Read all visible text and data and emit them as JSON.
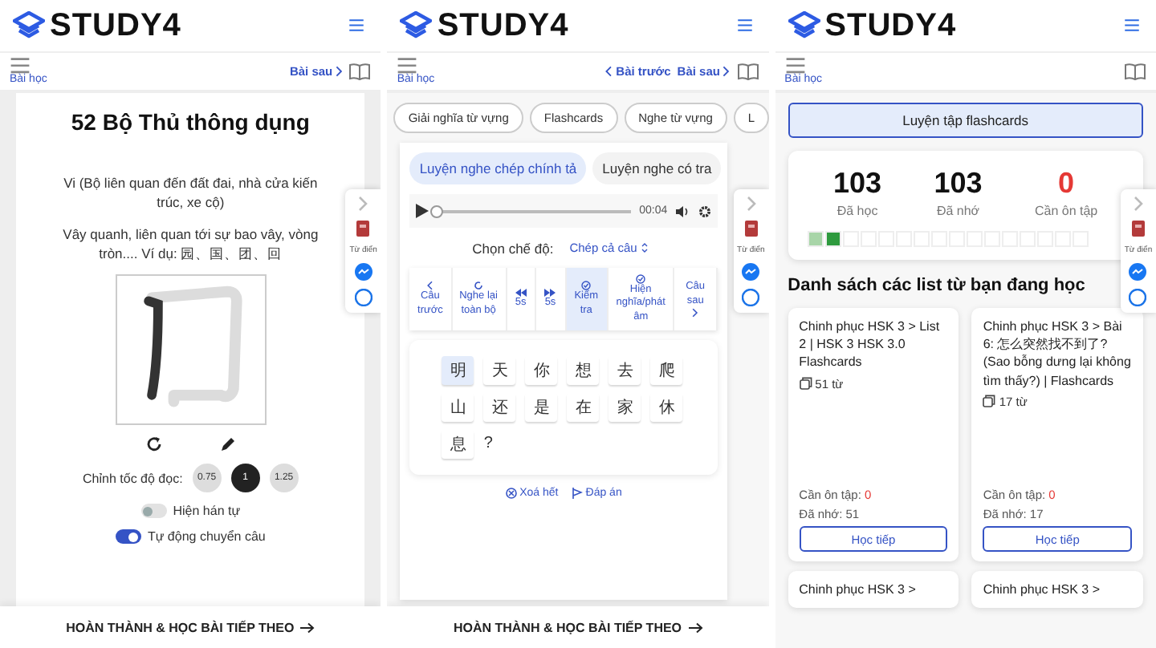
{
  "screens": [
    {
      "kind": "stroke",
      "logo": "STUDY4",
      "menu_label": "Bài học",
      "next_link": "Bài sau",
      "title": "52 Bộ Thủ thông dụng",
      "description": [
        "Vi (Bộ liên quan đến đất đai, nhà cửa kiến trúc, xe cộ)",
        "Vây quanh, liên quan tới sự bao vây, vòng tròn.... Ví dụ: 园、国、团、回"
      ],
      "speed_label": "Chỉnh tốc độ đọc:",
      "speeds": [
        {
          "label": "0.75",
          "selected": false
        },
        {
          "label": "1",
          "selected": true
        },
        {
          "label": "1.25",
          "selected": false
        }
      ],
      "toggles": [
        {
          "label": "Hiện hán tự",
          "on": false
        },
        {
          "label": "Tự động chuyển câu",
          "on": true
        }
      ],
      "footer": "HOÀN THÀNH & HỌC BÀI TIẾP THEO",
      "dictionary_label": "Từ điển"
    },
    {
      "kind": "dictation",
      "logo": "STUDY4",
      "menu_label": "Bài học",
      "prev_link": "Bài trước",
      "next_link": "Bài sau",
      "chips": [
        "Giải nghĩa từ vựng",
        "Flashcards",
        "Nghe từ vựng",
        "L"
      ],
      "modes": [
        {
          "label": "Luyện nghe chép chính tả",
          "selected": true
        },
        {
          "label": "Luyện nghe có tra",
          "selected": false
        }
      ],
      "player": {
        "level": 0,
        "time": "00:04"
      },
      "mode_label": "Chọn chế độ:",
      "mode_value": "Chép cả câu",
      "controls": [
        {
          "kind": "prev",
          "label": "Câu trước",
          "active": false
        },
        {
          "kind": "replay",
          "label": "Nghe lại toàn bộ",
          "active": false
        },
        {
          "kind": "back",
          "label": "5s",
          "active": false
        },
        {
          "kind": "forward",
          "label": "5s",
          "active": false
        },
        {
          "kind": "check",
          "label": "Kiểm tra",
          "active": true
        },
        {
          "kind": "meaning",
          "label": "Hiện nghĩa/phát âm",
          "active": false
        },
        {
          "kind": "next",
          "label": "Câu sau",
          "active": false
        }
      ],
      "tiles": [
        {
          "text": "明",
          "selected": true
        },
        {
          "text": "天",
          "selected": false
        },
        {
          "text": "你",
          "selected": false
        },
        {
          "text": "想",
          "selected": false
        },
        {
          "text": "去",
          "selected": false
        },
        {
          "text": "爬",
          "selected": false
        },
        {
          "text": "山",
          "selected": false
        },
        {
          "text": "还",
          "selected": false
        },
        {
          "text": "是",
          "selected": false
        },
        {
          "text": "在",
          "selected": false
        },
        {
          "text": "家",
          "selected": false
        },
        {
          "text": "休",
          "selected": false
        },
        {
          "text": "息",
          "selected": false
        }
      ],
      "trailing": "?",
      "actions": [
        {
          "kind": "clear",
          "label": "Xoá hết"
        },
        {
          "kind": "answer",
          "label": "Đáp án"
        }
      ],
      "footer": "HOÀN THÀNH & HỌC BÀI TIẾP THEO",
      "dictionary_label": "Từ điển"
    },
    {
      "kind": "flashcards",
      "logo": "STUDY4",
      "menu_label": "Bài học",
      "practice_button": "Luyện tập flashcards",
      "stats": [
        {
          "value": "103",
          "label": "Đã học",
          "alert": false
        },
        {
          "value": "103",
          "label": "Đã nhớ",
          "alert": false
        },
        {
          "value": "0",
          "label": "Cần ôn tập",
          "alert": true
        }
      ],
      "boxes": [
        {
          "kind": "learned"
        },
        {
          "kind": "remembered"
        },
        {
          "kind": "empty"
        },
        {
          "kind": "empty"
        },
        {
          "kind": "empty"
        },
        {
          "kind": "empty"
        },
        {
          "kind": "empty"
        },
        {
          "kind": "empty"
        },
        {
          "kind": "empty"
        },
        {
          "kind": "empty"
        },
        {
          "kind": "empty"
        },
        {
          "kind": "empty"
        },
        {
          "kind": "empty"
        },
        {
          "kind": "empty"
        },
        {
          "kind": "empty"
        },
        {
          "kind": "empty"
        }
      ],
      "list_heading": "Danh sách các list từ bạn đang học",
      "lists": [
        {
          "title": "Chinh phục HSK 3 > List 2 | HSK 3 HSK 3.0 Flashcards",
          "count": "51 từ",
          "review_label": "Cần ôn tập:",
          "review_value": "0",
          "remembered": "Đã nhớ: 51",
          "button": "Học tiếp"
        },
        {
          "title": "Chinh phục HSK 3 > Bài 6: 怎么突然找不到了? (Sao bỗng dưng lại không tìm thấy?) | Flashcards",
          "count": "17 từ",
          "review_label": "Cần ôn tập:",
          "review_value": "0",
          "remembered": "Đã nhớ: 17",
          "button": "Học tiếp"
        },
        {
          "title": "Chinh phục HSK 3 >"
        },
        {
          "title": "Chinh phục HSK 3 >"
        }
      ],
      "dictionary_label": "Từ điển"
    }
  ]
}
